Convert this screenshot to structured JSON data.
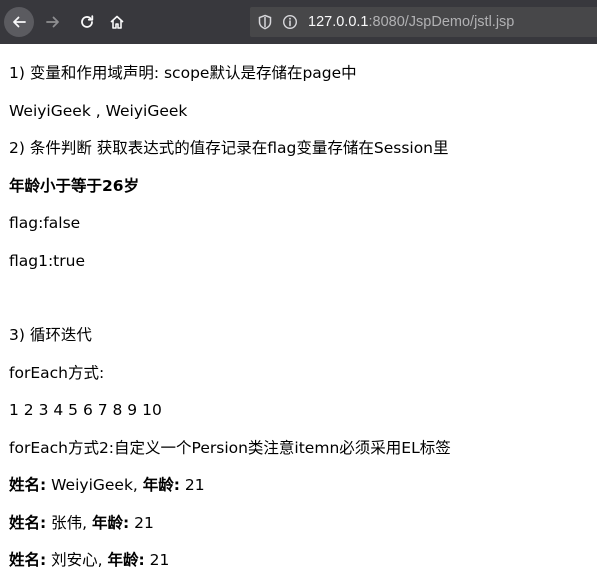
{
  "browser": {
    "url_host": "127.0.0.1",
    "url_rest": ":8080/JspDemo/jstl.jsp"
  },
  "page": {
    "line1": "1) 变量和作用域声明: scope默认是存储在page中",
    "line2": "WeiyiGeek , WeiyiGeek",
    "line3": "2) 条件判断 获取表达式的值存记录在flag变量存储在Session里",
    "line4": "年龄小于等于26岁",
    "line5": "flag:false",
    "line6": "flag1:true",
    "line7": "3) 循环迭代",
    "line8": "forEach方式:",
    "line9": "1 2 3 4 5 6 7 8 9 10",
    "line10": "forEach方式2:自定义一个Persion类注意itemn必须采用EL标签",
    "persons": [
      {
        "name_label": "姓名:",
        "name": " WeiyiGeek, ",
        "age_label": "年龄:",
        "age": " 21"
      },
      {
        "name_label": "姓名:",
        "name": " 张伟, ",
        "age_label": "年龄:",
        "age": " 21"
      },
      {
        "name_label": "姓名:",
        "name": " 刘安心, ",
        "age_label": "年龄:",
        "age": " 21"
      }
    ]
  }
}
